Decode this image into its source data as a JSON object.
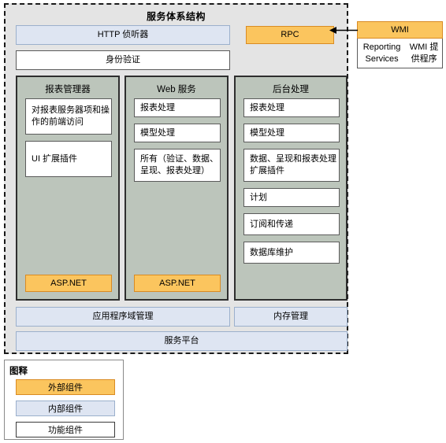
{
  "diagram": {
    "title": "服务体系结构"
  },
  "top_strips": {
    "http_listener": "HTTP 侦听器",
    "rpc": "RPC",
    "authentication": "身份验证"
  },
  "wmi": {
    "header": "WMI",
    "provider_line_1": "Reporting Services",
    "provider_line_2": "WMI 提供程序"
  },
  "tiers": [
    {
      "id": "report-manager",
      "title": "报表管理器",
      "items": [
        "对报表服务器项和操作的前端访问",
        "UI 扩展插件"
      ],
      "platform": "ASP.NET"
    },
    {
      "id": "web-service",
      "title": "Web 服务",
      "items": [
        "报表处理",
        "模型处理",
        "所有（验证、数据、呈现、报表处理）"
      ],
      "platform": "ASP.NET"
    },
    {
      "id": "background-processing",
      "title": "后台处理",
      "items": [
        "报表处理",
        "模型处理",
        "数据、呈现和报表处理扩展插件",
        "计划",
        "订阅和传递",
        "数据库维护"
      ],
      "platform": null
    }
  ],
  "bottom_strips": {
    "appdomain_management": "应用程序域管理",
    "memory_management": "内存管理",
    "service_platform": "服务平台"
  },
  "legend": {
    "title": "图释",
    "items": [
      {
        "label": "外部组件",
        "kind": "external",
        "color": "#fbc55e"
      },
      {
        "label": "内部组件",
        "kind": "internal",
        "color": "#dee5f2"
      },
      {
        "label": "功能组件",
        "kind": "feature",
        "color": "#ffffff"
      }
    ]
  },
  "colors": {
    "container_background": "#e4e4e4",
    "tier_background": "#bcc5bb",
    "external": "#fbc55e",
    "external_border": "#d98b23",
    "internal": "#dee5f2",
    "internal_border": "#9bb0cc",
    "feature": "#ffffff",
    "feature_border": "#5b5b5b"
  }
}
